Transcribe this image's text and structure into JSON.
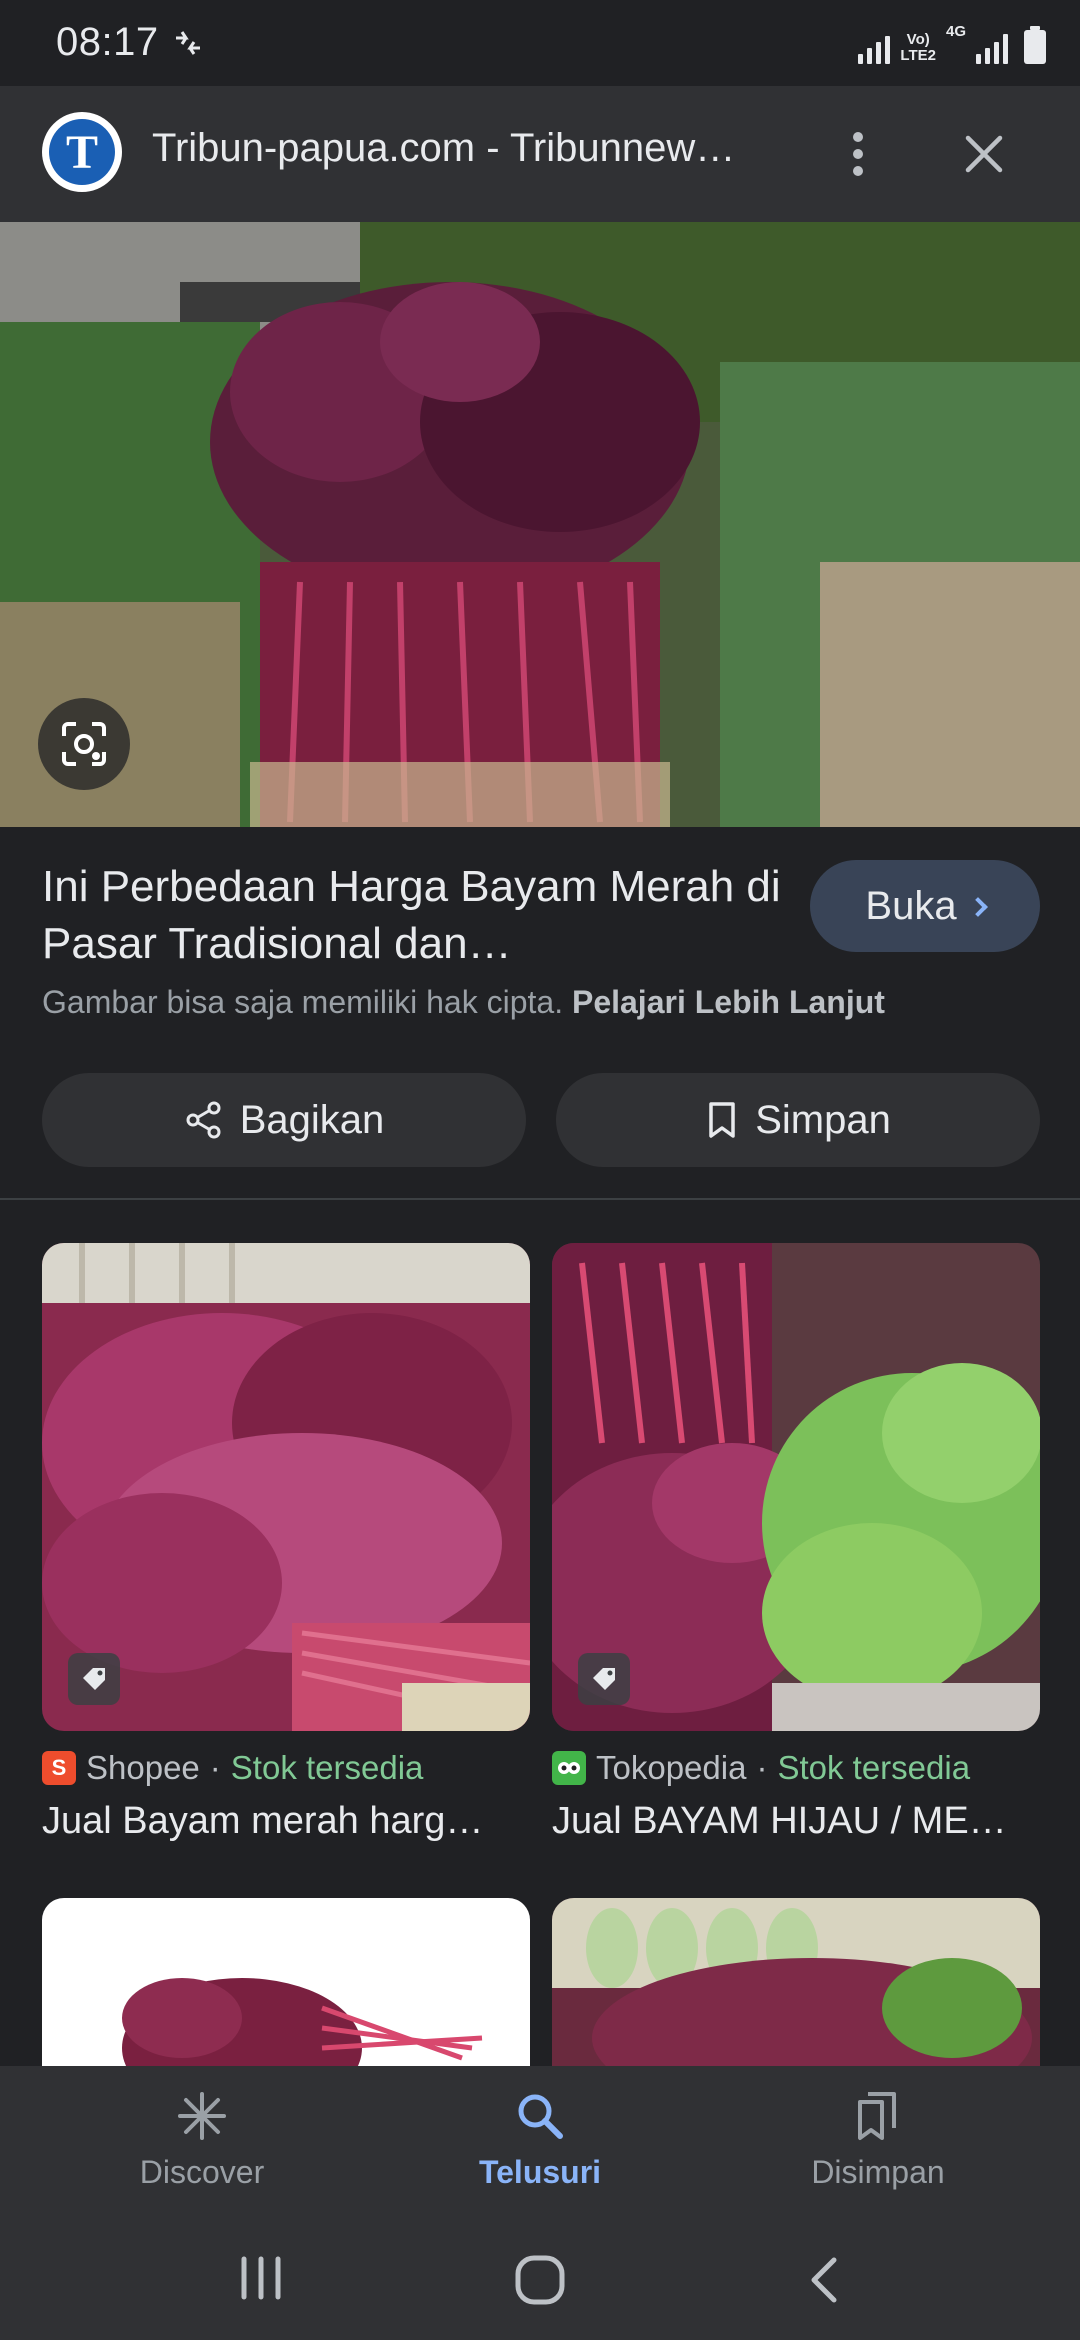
{
  "status_bar": {
    "time": "08:17",
    "network_line1": "Vo)",
    "network_line2": "LTE2",
    "network_type": "4G"
  },
  "header": {
    "site_logo_letter": "T",
    "title": "Tribun-papua.com - Tribunnew…"
  },
  "result": {
    "title": "Ini Perbedaan Harga Bayam Merah di Pasar Tradisional dan…",
    "open_label": "Buka",
    "copyright_text": "Gambar bisa saja memiliki hak cipta.",
    "learn_more": "Pelajari Lebih Lanjut"
  },
  "actions": {
    "share_label": "Bagikan",
    "save_label": "Simpan"
  },
  "related": [
    {
      "source": "Shopee",
      "separator": " · ",
      "stock": "Stok tersedia",
      "title": "Jual Bayam merah harg…",
      "source_icon_color": "#ee4d2d"
    },
    {
      "source": "Tokopedia",
      "separator": " · ",
      "stock": "Stok tersedia",
      "title": "Jual BAYAM HIJAU / ME…",
      "source_icon_color": "#42b549"
    }
  ],
  "bottom_nav": {
    "items": [
      {
        "label": "Discover",
        "icon": "asterisk-icon"
      },
      {
        "label": "Telusuri",
        "icon": "search-icon",
        "active": true
      },
      {
        "label": "Disimpan",
        "icon": "bookmarks-icon"
      }
    ]
  },
  "colors": {
    "background": "#202124",
    "surface": "#303134",
    "accent": "#8ab4f8",
    "stock_green": "#81c995",
    "open_button": "#394457"
  }
}
